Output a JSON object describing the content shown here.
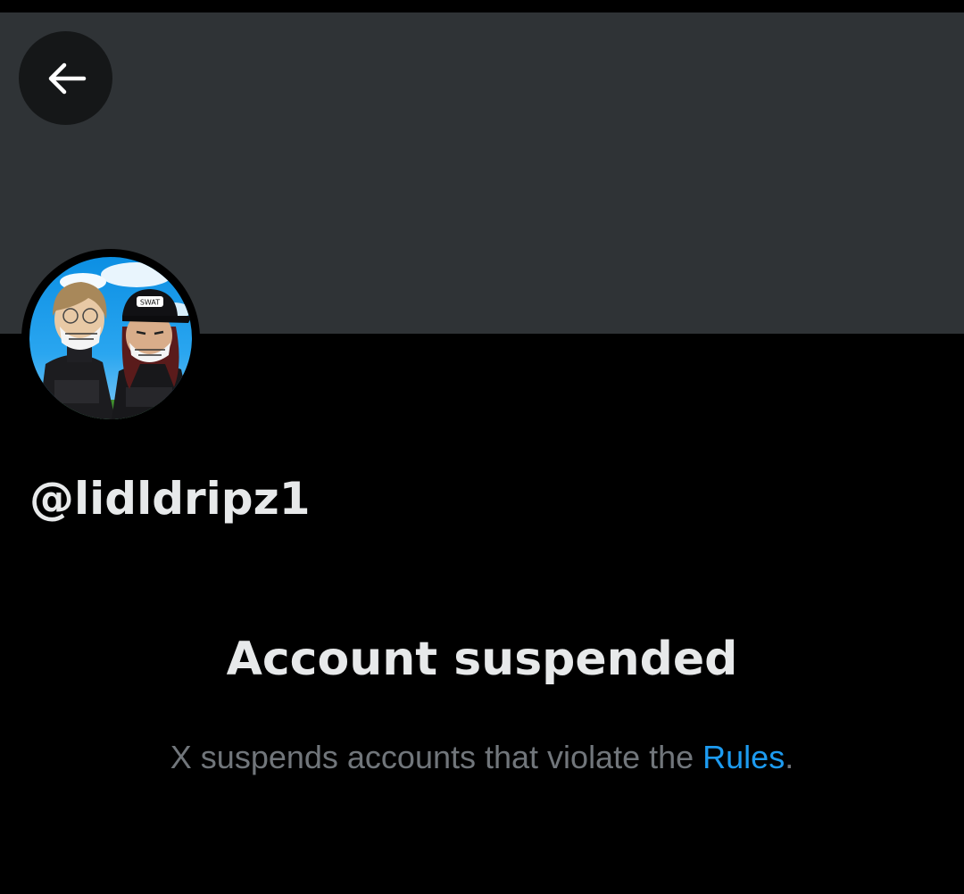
{
  "header": {
    "back_icon": "arrow-left-icon"
  },
  "profile": {
    "avatar_icon": "avatar-illustration",
    "handle": "@lidldripz1",
    "avatar_cap_text": "SWAT"
  },
  "notice": {
    "title": "Account suspended",
    "message_prefix": "X suspends accounts that violate the ",
    "rules_link": "Rules",
    "message_suffix": "."
  },
  "colors": {
    "background": "#000000",
    "banner": "#2f3336",
    "text_primary": "#e7e9ea",
    "text_secondary": "#71767b",
    "link": "#1d9bf0"
  }
}
